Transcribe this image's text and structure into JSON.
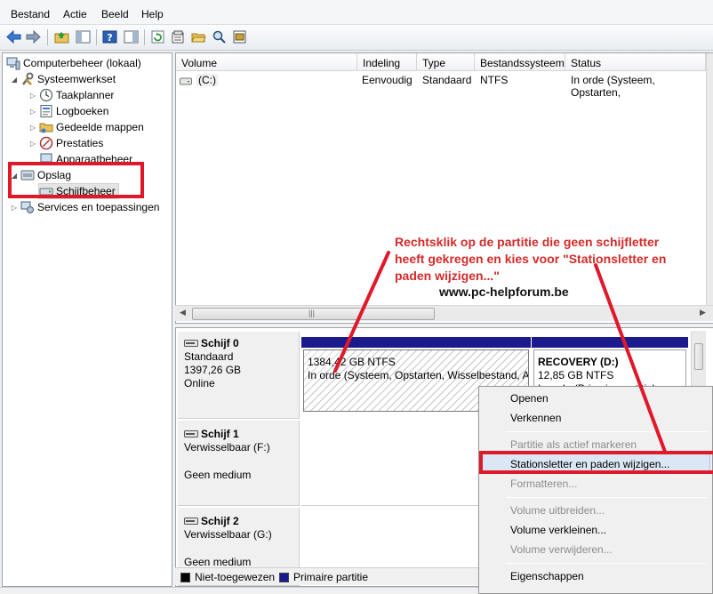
{
  "menubar": {
    "items": [
      "Bestand",
      "Actie",
      "Beeld",
      "Help"
    ]
  },
  "toolbar": {
    "icons": [
      "back-icon",
      "forward-icon",
      "up-folder-icon",
      "show-hide-tree-icon",
      "help-icon",
      "show-hide-action-pane-icon",
      "refresh-icon",
      "properties-icon",
      "open-icon",
      "search-icon",
      "settings-icon"
    ]
  },
  "tree": {
    "root": "Computerbeheer (lokaal)",
    "system_tools": "Systeemwerkset",
    "task_scheduler": "Taakplanner",
    "event_viewer": "Logboeken",
    "shared_folders": "Gedeelde mappen",
    "performance": "Prestaties",
    "device_manager": "Apparaatbeheer",
    "storage": "Opslag",
    "disk_management": "Schijfbeheer",
    "services": "Services en toepassingen"
  },
  "volumes": {
    "columns": [
      "Volume",
      "Indeling",
      "Type",
      "Bestandssysteem",
      "Status"
    ],
    "rows": [
      {
        "volume": "(C:)",
        "layout": "Eenvoudig",
        "type": "Standaard",
        "fs": "NTFS",
        "status": "In orde (Systeem, Opstarten,"
      }
    ],
    "scroll_grip": "|||"
  },
  "disks": [
    {
      "name": "Schijf 0",
      "type": "Standaard",
      "size": "1397,26 GB",
      "state": "Online"
    },
    {
      "name": "Schijf 1",
      "type": "Verwisselbaar (F:)",
      "state": "Geen medium"
    },
    {
      "name": "Schijf 2",
      "type": "Verwisselbaar (G:)",
      "state": "Geen medium"
    }
  ],
  "partitions": {
    "main": {
      "size": "1384,42 GB NTFS",
      "status": "In orde (Systeem, Opstarten, Wisselbestand, A"
    },
    "recovery": {
      "label": "RECOVERY  (D:)",
      "size": "12,85 GB NTFS",
      "status": "In orde (Primaire partitie)"
    }
  },
  "legend": {
    "unallocated": "Niet-toegewezen",
    "primary": "Primaire partitie"
  },
  "context_menu": {
    "open": "Openen",
    "explore": "Verkennen",
    "mark_active": "Partitie als actief markeren",
    "change_letter": "Stationsletter en paden wijzigen...",
    "format": "Formatteren...",
    "extend": "Volume uitbreiden...",
    "shrink": "Volume verkleinen...",
    "delete": "Volume verwijderen...",
    "properties": "Eigenschappen"
  },
  "annotation": {
    "line1": "Rechtsklik op de partitie die geen schijfletter",
    "line2": "heeft gekregen en kies voor \"Stationsletter en",
    "line3": "paden wijzigen...\"",
    "site": "www.pc-helpforum.be"
  },
  "colors": {
    "annotation": "#e0192a",
    "primary_partition": "#1b1b8e",
    "unallocated": "#000000"
  }
}
